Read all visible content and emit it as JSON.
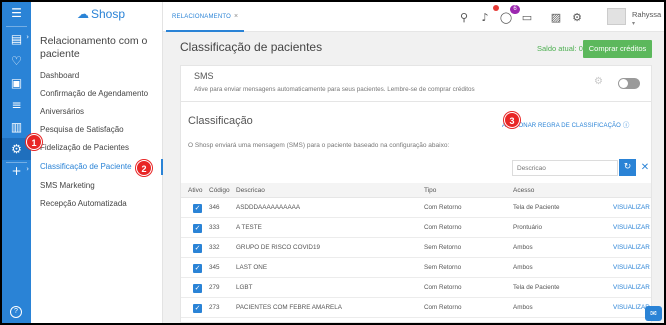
{
  "app": {
    "logo_text": "Shosp"
  },
  "rail": {
    "icons": [
      "menu-icon",
      "dashboard-icon",
      "heart-icon",
      "money-icon",
      "database-icon",
      "briefcase-icon",
      "user-settings-icon",
      "plus-icon",
      "help-icon"
    ]
  },
  "sidebar": {
    "title": "Relacionamento com o paciente",
    "items": [
      {
        "label": "Dashboard"
      },
      {
        "label": "Confirmação de Agendamento"
      },
      {
        "label": "Aniversários"
      },
      {
        "label": "Pesquisa de Satisfação"
      },
      {
        "label": "Fidelização de Pacientes"
      },
      {
        "label": "Classificação de Paciente"
      },
      {
        "label": "SMS Marketing"
      },
      {
        "label": "Recepção Automatizada"
      }
    ]
  },
  "topbar": {
    "tab_label": "RELACIONAMENTO",
    "tab_close": "×",
    "badges": {
      "notifications": "",
      "messages": "6"
    },
    "badge_colors": {
      "notifications": "#e53935",
      "messages": "#9c27b0"
    },
    "user_name": "Rahyssa"
  },
  "main": {
    "page_title": "Classificação de pacientes",
    "balance": "Saldo atual: 0",
    "buy_button": "Comprar créditos",
    "sms": {
      "title": "SMS",
      "description": "Ative para enviar mensagens automaticamente para seus pacientes. Lembre-se de comprar créditos",
      "enabled": false
    },
    "classification": {
      "title": "Classificação",
      "add_rule": "ADICIONAR REGRA DE CLASSIFICAÇÃO",
      "description": "O Shosp enviará uma mensagem (SMS) para o paciente baseado na configuração abaixo:",
      "search_placeholder": "Descricao",
      "table": {
        "headers": {
          "ativo": "Ativo",
          "codigo": "Código",
          "descricao": "Descricao",
          "tipo": "Tipo",
          "acesso": "Acesso"
        },
        "rows": [
          {
            "active": true,
            "code": "346",
            "description": "ASDDDAAAAAAAAAA",
            "tipo": "Com Retorno",
            "acesso": "Tela de Paciente",
            "action": "VISUALIZAR"
          },
          {
            "active": true,
            "code": "333",
            "description": "A TESTE",
            "tipo": "Com Retorno",
            "acesso": "Prontuário",
            "action": "VISUALIZAR"
          },
          {
            "active": true,
            "code": "332",
            "description": "GRUPO DE RISCO COVID19",
            "tipo": "Sem Retorno",
            "acesso": "Ambos",
            "action": "VISUALIZAR"
          },
          {
            "active": true,
            "code": "345",
            "description": "LAST ONE",
            "tipo": "Sem Retorno",
            "acesso": "Ambos",
            "action": "VISUALIZAR"
          },
          {
            "active": true,
            "code": "279",
            "description": "LGBT",
            "tipo": "Com Retorno",
            "acesso": "Tela de Paciente",
            "action": "VISUALIZAR"
          },
          {
            "active": true,
            "code": "273",
            "description": "PACIENTES COM FEBRE AMARELA",
            "tipo": "Com Retorno",
            "acesso": "Ambos",
            "action": "VISUALIZAR"
          }
        ]
      }
    }
  },
  "markers": [
    "1",
    "2",
    "3"
  ],
  "colors": {
    "primary": "#2a83d6",
    "success": "#5cb85c",
    "marker": "#e82626"
  }
}
